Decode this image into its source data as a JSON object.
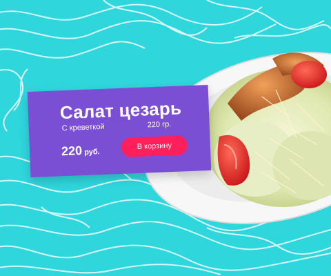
{
  "product": {
    "name": "Салат цезарь",
    "description": "С креветкой",
    "weight": "220 гр.",
    "price": "220",
    "currency": "руб.",
    "add_to_cart_label": "В корзину"
  },
  "colors": {
    "background": "#2fd6dc",
    "card": "#7b4fd3",
    "button": "#ff1f5b"
  }
}
